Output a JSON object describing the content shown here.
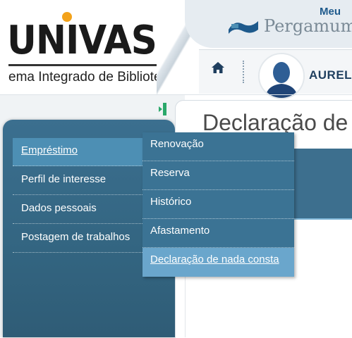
{
  "header": {
    "logo_text": "UNIVASF",
    "logo_subtitle": "ema Integrado de Bibliote",
    "meu_label": "Meu",
    "pergamum_label": "Pergamum",
    "user_name": "AUREL",
    "icons": {
      "home": "home-icon",
      "avatar": "user-avatar-icon",
      "pergamum": "pergamum-logo-icon"
    }
  },
  "sidebar": {
    "collapse_icon": "collapse-sidebar-icon",
    "items": [
      {
        "label": "Empréstimo",
        "active": true
      },
      {
        "label": "Perfil de interesse",
        "active": false
      },
      {
        "label": "Dados pessoais",
        "active": false
      },
      {
        "label": "Postagem de trabalhos",
        "active": false
      }
    ]
  },
  "submenu": {
    "items": [
      {
        "label": "Renovação",
        "active": false
      },
      {
        "label": "Reserva",
        "active": false
      },
      {
        "label": "Histórico",
        "active": false
      },
      {
        "label": "Afastamento",
        "active": false
      },
      {
        "label": "Declaração de nada consta",
        "active": true
      }
    ]
  },
  "main": {
    "title": "Declaração de"
  },
  "colors": {
    "sidebar": "#336581",
    "menu_active": "#4d8fb4",
    "submenu": "#3b7394",
    "submenu_active": "#6aa6cc",
    "brand_orange": "#f3a21a",
    "accent_blue": "#1e5a8c"
  }
}
